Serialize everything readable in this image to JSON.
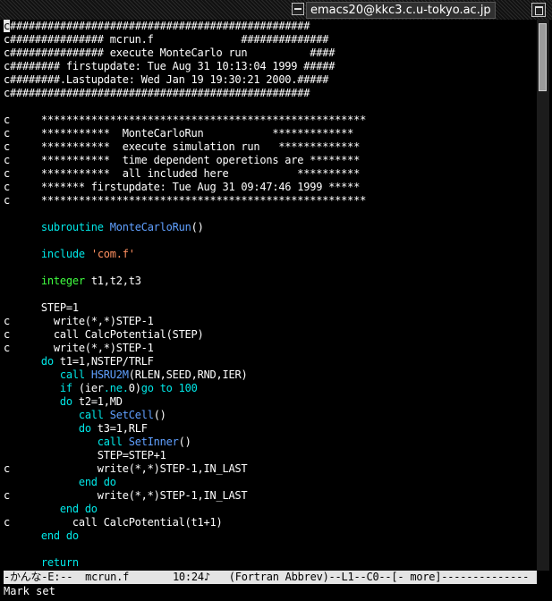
{
  "window": {
    "title": "emacs20@kkc3.c.u-tokyo.ac.jp",
    "menu_icon": "window-menu-icon",
    "maximize_icon": "maximize-icon"
  },
  "buffer": {
    "lines": [
      [
        {
          "t": "c",
          "c": "cursor"
        },
        {
          "t": "################################################"
        }
      ],
      [
        {
          "t": "c############### mcrun.f              ##############"
        }
      ],
      [
        {
          "t": "c############### execute MonteCarlo run          ####"
        }
      ],
      [
        {
          "t": "c######## firstupdate: Tue Aug 31 10:13:04 1999 #####"
        }
      ],
      [
        {
          "t": "c########.Lastupdate: Wed Jan 19 19:30:21 2000.#####"
        }
      ],
      [
        {
          "t": "c################################################"
        }
      ],
      [
        {
          "t": ""
        }
      ],
      [
        {
          "t": "c     ****************************************************"
        }
      ],
      [
        {
          "t": "c     ***********  MonteCarloRun           *************"
        }
      ],
      [
        {
          "t": "c     ***********  execute simulation run   *************"
        }
      ],
      [
        {
          "t": "c     ***********  time dependent operetions are ********"
        }
      ],
      [
        {
          "t": "c     ***********  all included here           **********"
        }
      ],
      [
        {
          "t": "c     ******* firstupdate: Tue Aug 31 09:47:46 1999 *****"
        }
      ],
      [
        {
          "t": "c     ****************************************************"
        }
      ],
      [
        {
          "t": ""
        }
      ],
      [
        {
          "t": "      "
        },
        {
          "t": "subroutine",
          "c": "kw"
        },
        {
          "t": " "
        },
        {
          "t": "MonteCarloRun",
          "c": "fn"
        },
        {
          "t": "()"
        }
      ],
      [
        {
          "t": ""
        }
      ],
      [
        {
          "t": "      "
        },
        {
          "t": "include",
          "c": "kw"
        },
        {
          "t": " "
        },
        {
          "t": "'com.f'",
          "c": "str"
        }
      ],
      [
        {
          "t": ""
        }
      ],
      [
        {
          "t": "      "
        },
        {
          "t": "integer",
          "c": "ty"
        },
        {
          "t": " t1,t2,t3"
        }
      ],
      [
        {
          "t": ""
        }
      ],
      [
        {
          "t": "      STEP=1"
        }
      ],
      [
        {
          "t": "c       write(*,*)STEP-1"
        }
      ],
      [
        {
          "t": "c       call CalcPotential(STEP)"
        }
      ],
      [
        {
          "t": "c       write(*,*)STEP-1"
        }
      ],
      [
        {
          "t": "      "
        },
        {
          "t": "do",
          "c": "kw"
        },
        {
          "t": " t1=1,NSTEP/TRLF"
        }
      ],
      [
        {
          "t": "         "
        },
        {
          "t": "call",
          "c": "kw"
        },
        {
          "t": " "
        },
        {
          "t": "HSRU2M",
          "c": "fn"
        },
        {
          "t": "(RLEN,SEED,RND,IER)"
        }
      ],
      [
        {
          "t": "         "
        },
        {
          "t": "if",
          "c": "kw"
        },
        {
          "t": " (ier"
        },
        {
          "t": ".ne.",
          "c": "kw"
        },
        {
          "t": "0)"
        },
        {
          "t": "go to",
          "c": "kw"
        },
        {
          "t": " "
        },
        {
          "t": "100",
          "c": "kw"
        }
      ],
      [
        {
          "t": "         "
        },
        {
          "t": "do",
          "c": "kw"
        },
        {
          "t": " t2=1,MD"
        }
      ],
      [
        {
          "t": "            "
        },
        {
          "t": "call",
          "c": "kw"
        },
        {
          "t": " "
        },
        {
          "t": "SetCell",
          "c": "fn"
        },
        {
          "t": "()"
        }
      ],
      [
        {
          "t": "            "
        },
        {
          "t": "do",
          "c": "kw"
        },
        {
          "t": " t3=1,RLF"
        }
      ],
      [
        {
          "t": "               "
        },
        {
          "t": "call",
          "c": "kw"
        },
        {
          "t": " "
        },
        {
          "t": "SetInner",
          "c": "fn"
        },
        {
          "t": "()"
        }
      ],
      [
        {
          "t": "               STEP=STEP+1"
        }
      ],
      [
        {
          "t": "c              write(*,*)STEP-1,IN_LAST"
        }
      ],
      [
        {
          "t": "            "
        },
        {
          "t": "end do",
          "c": "kw"
        }
      ],
      [
        {
          "t": "c              write(*,*)STEP-1,IN_LAST"
        }
      ],
      [
        {
          "t": "         "
        },
        {
          "t": "end do",
          "c": "kw"
        }
      ],
      [
        {
          "t": "c          call CalcPotential(t1+1)"
        }
      ],
      [
        {
          "t": "      "
        },
        {
          "t": "end do",
          "c": "kw"
        }
      ],
      [
        {
          "t": ""
        }
      ],
      [
        {
          "t": "      "
        },
        {
          "t": "return",
          "c": "kw"
        }
      ]
    ]
  },
  "modeline": {
    "text": "-かんな-E:--  mcrun.f       10:24♪   (Fortran Abbrev)--L1--C0--[- more]--------------"
  },
  "minibuffer": {
    "text": "Mark set"
  },
  "colors": {
    "background": "#000000",
    "foreground": "#ffffff",
    "keyword": "#00e8e8",
    "type": "#40ff40",
    "string": "#ff9060",
    "function": "#60a0ff",
    "modeline_bg": "#e4e4e4"
  },
  "scrollbar": {
    "position_fraction": 0.0,
    "visible_fraction": 0.12
  }
}
